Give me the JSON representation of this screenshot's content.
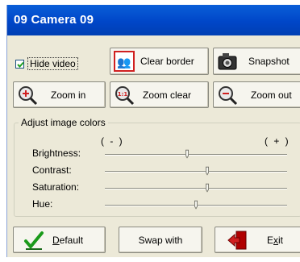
{
  "window": {
    "title": "09 Camera 09"
  },
  "hide_video": {
    "label": "Hide video",
    "checked": true
  },
  "buttons": {
    "clear_border": "Clear border",
    "snapshot": "Snapshot",
    "zoom_in": "Zoom in",
    "zoom_clear": "Zoom clear",
    "zoom_out": "Zoom out",
    "default_pre": "",
    "default_u": "D",
    "default_rest": "efault",
    "swap_with": "Swap with",
    "exit_pre": "E",
    "exit_u": "x",
    "exit_rest": "it"
  },
  "adjust": {
    "legend": "Adjust image colors",
    "minus_label": "( - )",
    "plus_label": "( + )",
    "sliders": [
      {
        "label": "Brightness:",
        "value": 0.45
      },
      {
        "label": "Contrast:",
        "value": 0.56
      },
      {
        "label": "Saturation:",
        "value": 0.56
      },
      {
        "label": "Hue:",
        "value": 0.5
      }
    ]
  },
  "colors": {
    "titlebar": "#0050d0",
    "dialog_bg": "#ece9d8",
    "title_text": "#ffffff"
  }
}
